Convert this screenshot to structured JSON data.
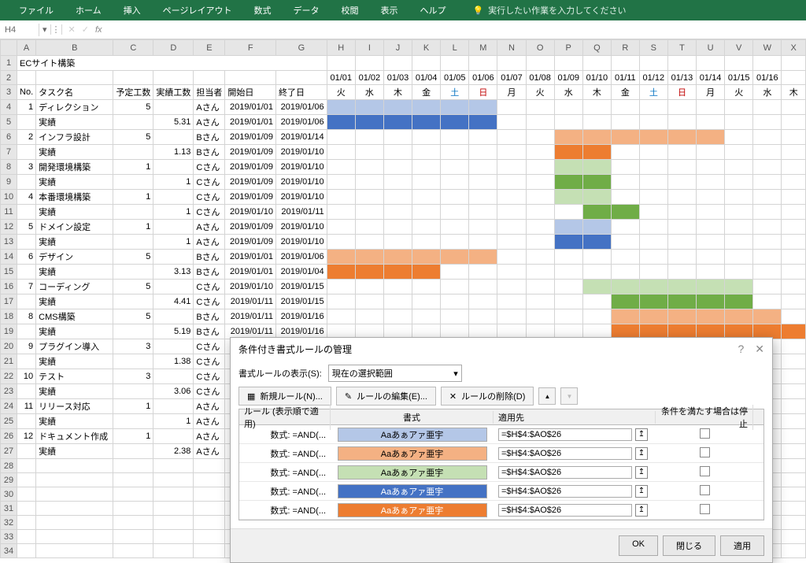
{
  "ribbon": {
    "tabs": [
      "ファイル",
      "ホーム",
      "挿入",
      "ページレイアウト",
      "数式",
      "データ",
      "校閲",
      "表示",
      "ヘルプ"
    ],
    "tell_me": "実行したい作業を入力してください"
  },
  "name_box": {
    "cell": "H4",
    "fx": "fx"
  },
  "sheet": {
    "title": "ECサイト構築",
    "col_letters": [
      "A",
      "B",
      "C",
      "D",
      "E",
      "F",
      "G",
      "H",
      "I",
      "J",
      "K",
      "L",
      "M",
      "N",
      "O",
      "P",
      "Q",
      "R",
      "S",
      "T",
      "U",
      "V",
      "W",
      "X"
    ],
    "date_hdr": [
      "01/01",
      "01/02",
      "01/03",
      "01/04",
      "01/05",
      "01/06",
      "01/07",
      "01/08",
      "01/09",
      "01/10",
      "01/11",
      "01/12",
      "01/13",
      "01/14",
      "01/15",
      "01/16"
    ],
    "dow_hdr": [
      "火",
      "水",
      "木",
      "金",
      "土",
      "日",
      "月",
      "火",
      "水",
      "木",
      "金",
      "土",
      "日",
      "月",
      "火",
      "水",
      "木"
    ],
    "header": {
      "no": "No.",
      "task": "タスク名",
      "plan": "予定工数",
      "act": "実績工数",
      "person": "担当者",
      "start": "開始日",
      "end": "終了日"
    },
    "rows": [
      {
        "no": 1,
        "task": "ディレクション",
        "plan": 5,
        "act": "",
        "person": "Aさん",
        "start": "2019/01/01",
        "end": "2019/01/06",
        "bar_cls": "bar-lblue",
        "bar_from": 1,
        "bar_to": 6
      },
      {
        "no": "",
        "task": "実績",
        "plan": "",
        "act": 5.31,
        "person": "Aさん",
        "start": "2019/01/01",
        "end": "2019/01/06",
        "bar_cls": "bar-blue",
        "bar_from": 1,
        "bar_to": 6
      },
      {
        "no": 2,
        "task": "インフラ設計",
        "plan": 5,
        "act": "",
        "person": "Bさん",
        "start": "2019/01/09",
        "end": "2019/01/14",
        "bar_cls": "bar-lorange",
        "bar_from": 9,
        "bar_to": 14
      },
      {
        "no": "",
        "task": "実績",
        "plan": "",
        "act": 1.13,
        "person": "Bさん",
        "start": "2019/01/09",
        "end": "2019/01/10",
        "bar_cls": "bar-orange",
        "bar_from": 9,
        "bar_to": 10
      },
      {
        "no": 3,
        "task": "開発環境構築",
        "plan": 1,
        "act": "",
        "person": "Cさん",
        "start": "2019/01/09",
        "end": "2019/01/10",
        "bar_cls": "bar-lgreen",
        "bar_from": 9,
        "bar_to": 10
      },
      {
        "no": "",
        "task": "実績",
        "plan": "",
        "act": 1,
        "person": "Cさん",
        "start": "2019/01/09",
        "end": "2019/01/10",
        "bar_cls": "bar-green",
        "bar_from": 9,
        "bar_to": 10
      },
      {
        "no": 4,
        "task": "本番環境構築",
        "plan": 1,
        "act": "",
        "person": "Cさん",
        "start": "2019/01/09",
        "end": "2019/01/10",
        "bar_cls": "bar-lgreen",
        "bar_from": 9,
        "bar_to": 10
      },
      {
        "no": "",
        "task": "実績",
        "plan": "",
        "act": 1,
        "person": "Cさん",
        "start": "2019/01/10",
        "end": "2019/01/11",
        "bar_cls": "bar-green",
        "bar_from": 10,
        "bar_to": 11
      },
      {
        "no": 5,
        "task": "ドメイン設定",
        "plan": 1,
        "act": "",
        "person": "Aさん",
        "start": "2019/01/09",
        "end": "2019/01/10",
        "bar_cls": "bar-lblue",
        "bar_from": 9,
        "bar_to": 10
      },
      {
        "no": "",
        "task": "実績",
        "plan": "",
        "act": 1,
        "person": "Aさん",
        "start": "2019/01/09",
        "end": "2019/01/10",
        "bar_cls": "bar-blue",
        "bar_from": 9,
        "bar_to": 10
      },
      {
        "no": 6,
        "task": "デザイン",
        "plan": 5,
        "act": "",
        "person": "Bさん",
        "start": "2019/01/01",
        "end": "2019/01/06",
        "bar_cls": "bar-lorange",
        "bar_from": 1,
        "bar_to": 6
      },
      {
        "no": "",
        "task": "実績",
        "plan": "",
        "act": 3.13,
        "person": "Bさん",
        "start": "2019/01/01",
        "end": "2019/01/04",
        "bar_cls": "bar-orange",
        "bar_from": 1,
        "bar_to": 4
      },
      {
        "no": 7,
        "task": "コーディング",
        "plan": 5,
        "act": "",
        "person": "Cさん",
        "start": "2019/01/10",
        "end": "2019/01/15",
        "bar_cls": "bar-lgreen",
        "bar_from": 10,
        "bar_to": 15
      },
      {
        "no": "",
        "task": "実績",
        "plan": "",
        "act": 4.41,
        "person": "Cさん",
        "start": "2019/01/11",
        "end": "2019/01/15",
        "bar_cls": "bar-green",
        "bar_from": 11,
        "bar_to": 15
      },
      {
        "no": 8,
        "task": "CMS構築",
        "plan": 5,
        "act": "",
        "person": "Bさん",
        "start": "2019/01/11",
        "end": "2019/01/16",
        "bar_cls": "bar-lorange",
        "bar_from": 11,
        "bar_to": 16
      },
      {
        "no": "",
        "task": "実績",
        "plan": "",
        "act": 5.19,
        "person": "Bさん",
        "start": "2019/01/11",
        "end": "2019/01/16",
        "bar_cls": "bar-orange",
        "bar_from": 11,
        "bar_to": 17
      },
      {
        "no": 9,
        "task": "プラグイン導入",
        "plan": 3,
        "act": "",
        "person": "Cさん",
        "start": "",
        "end": "",
        "bar_cls": "",
        "bar_from": 0,
        "bar_to": 0
      },
      {
        "no": "",
        "task": "実績",
        "plan": "",
        "act": 1.38,
        "person": "Cさん",
        "start": "",
        "end": "",
        "bar_cls": "",
        "bar_from": 0,
        "bar_to": 0
      },
      {
        "no": 10,
        "task": "テスト",
        "plan": 3,
        "act": "",
        "person": "Cさん",
        "start": "",
        "end": "",
        "bar_cls": "",
        "bar_from": 0,
        "bar_to": 0
      },
      {
        "no": "",
        "task": "実績",
        "plan": "",
        "act": 3.06,
        "person": "Cさん",
        "start": "",
        "end": "",
        "bar_cls": "",
        "bar_from": 0,
        "bar_to": 0
      },
      {
        "no": 11,
        "task": "リリース対応",
        "plan": 1,
        "act": "",
        "person": "Aさん",
        "start": "",
        "end": "",
        "bar_cls": "",
        "bar_from": 0,
        "bar_to": 0
      },
      {
        "no": "",
        "task": "実績",
        "plan": "",
        "act": 1,
        "person": "Aさん",
        "start": "",
        "end": "",
        "bar_cls": "",
        "bar_from": 0,
        "bar_to": 0
      },
      {
        "no": 12,
        "task": "ドキュメント作成",
        "plan": 1,
        "act": "",
        "person": "Aさん",
        "start": "",
        "end": "",
        "bar_cls": "",
        "bar_from": 0,
        "bar_to": 0
      },
      {
        "no": "",
        "task": "実績",
        "plan": "",
        "act": 2.38,
        "person": "Aさん",
        "start": "",
        "end": "",
        "bar_cls": "",
        "bar_from": 0,
        "bar_to": 0
      }
    ]
  },
  "dialog": {
    "title": "条件付き書式ルールの管理",
    "show_rules_label": "書式ルールの表示(S):",
    "show_rules_value": "現在の選択範囲",
    "btn_new": "新規ルール(N)...",
    "btn_edit": "ルールの編集(E)...",
    "btn_delete": "ルールの削除(D)",
    "hdr_rule": "ルール (表示順で適用)",
    "hdr_format": "書式",
    "hdr_apply": "適用先",
    "hdr_stop": "条件を満たす場合は停止",
    "rule_label": "数式: =AND(...",
    "preview_text": "Aaあぁアァ亜宇",
    "apply_to": "=$H$4:$AO$26",
    "rules": [
      {
        "cls": "bar-lblue"
      },
      {
        "cls": "bar-lorange"
      },
      {
        "cls": "bar-lgreen"
      },
      {
        "cls": "bar-blue",
        "fg": "#fff"
      },
      {
        "cls": "bar-orange",
        "fg": "#fff"
      }
    ],
    "btn_ok": "OK",
    "btn_close": "閉じる",
    "btn_apply": "適用"
  }
}
